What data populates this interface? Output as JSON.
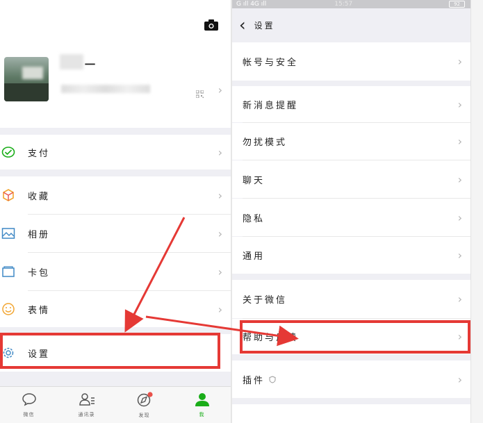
{
  "left": {
    "profile": {
      "name": "一",
      "camera_icon": "camera-icon",
      "qr_icon": "qr-code-icon"
    },
    "menu": {
      "pay": "支付",
      "favorites": "收藏",
      "album": "相册",
      "cards": "卡包",
      "emoji": "表情",
      "settings": "设置"
    },
    "tabs": [
      {
        "label": "微信"
      },
      {
        "label": "通讯录"
      },
      {
        "label": "发现"
      },
      {
        "label": "我"
      }
    ]
  },
  "right": {
    "status": {
      "signal": "G ıll 4G ıll",
      "time": "15:57",
      "battery": "92"
    },
    "title": "设置",
    "items": {
      "account_security": "帐号与安全",
      "new_message": "新消息提醒",
      "dnd": "勿扰模式",
      "chat": "聊天",
      "privacy": "隐私",
      "general": "通用",
      "about": "关于微信",
      "help": "帮助与反馈",
      "plugins": "插件"
    }
  },
  "chevron": "›",
  "back": "‹",
  "colors": {
    "accent_red": "#e53935",
    "wechat_green": "#1aad19",
    "page_bg": "#efeff4"
  }
}
